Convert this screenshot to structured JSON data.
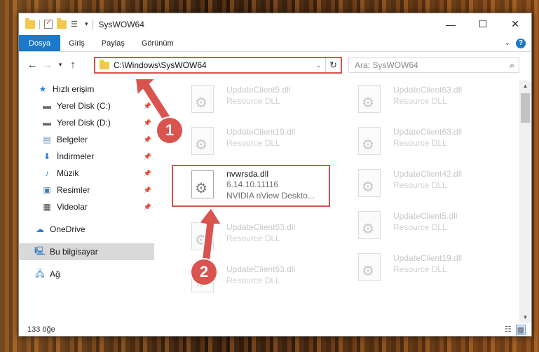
{
  "window": {
    "title": "SysWOW64",
    "controls": {
      "minimize": "—",
      "maximize": "☐",
      "close": "✕"
    }
  },
  "ribbon": {
    "tabs": [
      {
        "label": "Dosya",
        "active": true
      },
      {
        "label": "Giriş"
      },
      {
        "label": "Paylaş"
      },
      {
        "label": "Görünüm"
      }
    ],
    "help": "?"
  },
  "address": {
    "path": "C:\\Windows\\SysWOW64",
    "search_placeholder": "Ara: SysWOW64"
  },
  "sidebar": {
    "items": [
      {
        "label": "Hızlı erişim",
        "icon": "star-icon",
        "pinned": false
      },
      {
        "label": "Yerel Disk (C:)",
        "icon": "drive-icon",
        "pinned": true
      },
      {
        "label": "Yerel Disk (D:)",
        "icon": "drive-icon",
        "pinned": true
      },
      {
        "label": "Belgeler",
        "icon": "documents-icon",
        "pinned": true
      },
      {
        "label": "İndirmeler",
        "icon": "download-icon",
        "pinned": true
      },
      {
        "label": "Müzik",
        "icon": "music-icon",
        "pinned": true
      },
      {
        "label": "Resimler",
        "icon": "pictures-icon",
        "pinned": true
      },
      {
        "label": "Videolar",
        "icon": "video-icon",
        "pinned": true
      },
      {
        "label": "OneDrive",
        "icon": "cloud-icon",
        "pinned": false
      },
      {
        "label": "Bu bilgisayar",
        "icon": "computer-icon",
        "pinned": false,
        "selected": true
      },
      {
        "label": "Ağ",
        "icon": "network-icon",
        "pinned": false
      }
    ]
  },
  "files": {
    "left": [
      {
        "name": "UpdateClient5.dll",
        "desc": "Resource DLL"
      },
      {
        "name": "UpdateClient19.dll",
        "desc": "Resource DLL"
      },
      {
        "name": "nvwrsda.dll",
        "version": "6.14.10.11116",
        "desc": "NVIDIA nView Deskto...",
        "highlighted": true
      },
      {
        "name": "UpdateClient63.dll",
        "desc": "Resource DLL"
      },
      {
        "name": "UpdateClient63.dll",
        "desc": "Resource DLL"
      }
    ],
    "right": [
      {
        "name": "UpdateClient63.dll",
        "desc": "Resource DLL"
      },
      {
        "name": "UpdateClient63.dll",
        "desc": "Resource DLL"
      },
      {
        "name": "UpdateClient42.dll",
        "desc": "Resource DLL"
      },
      {
        "name": "UpdateClient5.dll",
        "desc": "Resource DLL"
      },
      {
        "name": "UpdateClient19.dll",
        "desc": "Resource DLL"
      }
    ]
  },
  "status": {
    "count": "133 öğe"
  },
  "annotations": {
    "step1": "1",
    "step2": "2",
    "color": "#d9534f"
  }
}
